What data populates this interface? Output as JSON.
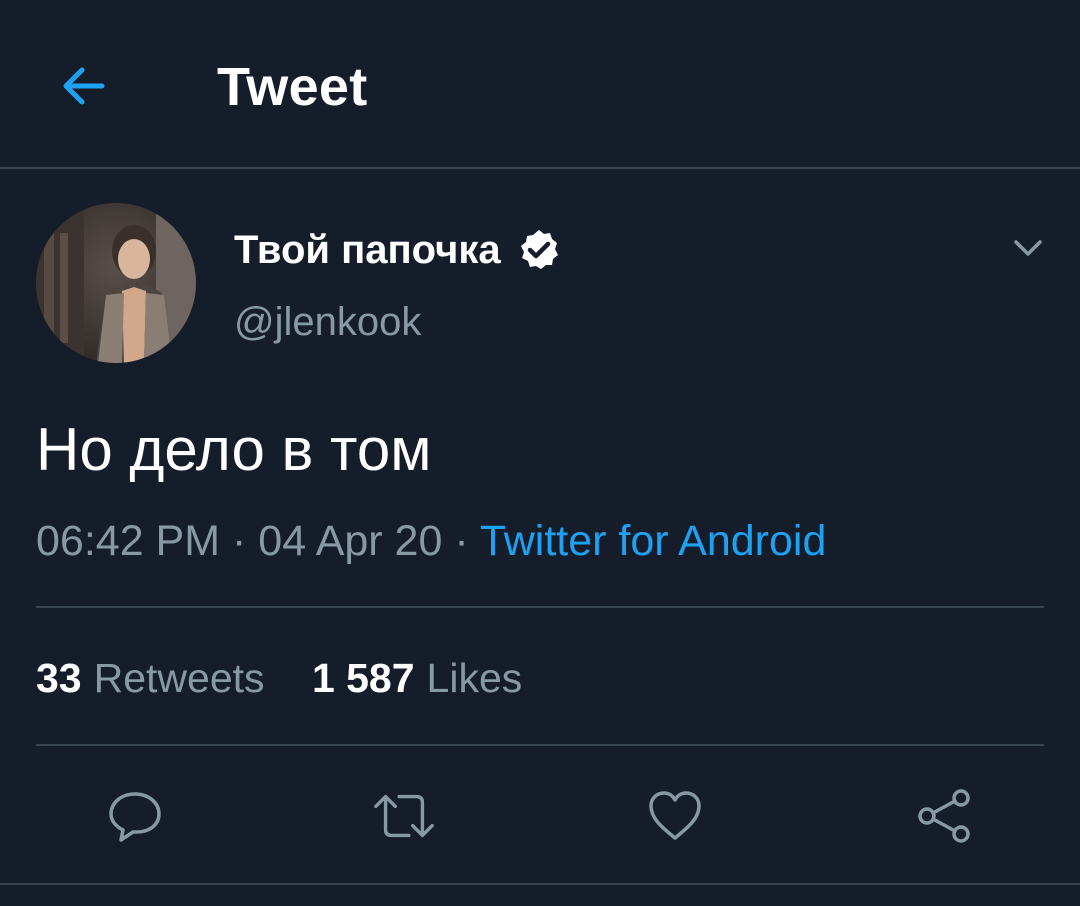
{
  "header": {
    "title": "Tweet",
    "back_icon": "arrow-left-icon"
  },
  "tweet": {
    "display_name": "Твой папочка",
    "verified": true,
    "username": "@jlenkook",
    "text": "Но дело в том",
    "time": "06:42 PM",
    "date": "04 Apr 20",
    "separator": "·",
    "source": "Twitter for Android"
  },
  "stats": {
    "retweets_count": "33",
    "retweets_label": "Retweets",
    "likes_count": "1 587",
    "likes_label": "Likes"
  },
  "actions": {
    "reply_icon": "reply-icon",
    "retweet_icon": "retweet-icon",
    "like_icon": "heart-icon",
    "share_icon": "share-icon"
  },
  "colors": {
    "background": "#161d2a",
    "accent": "#1da1f2",
    "secondary_text": "#8899a6",
    "divider": "#38444d"
  }
}
